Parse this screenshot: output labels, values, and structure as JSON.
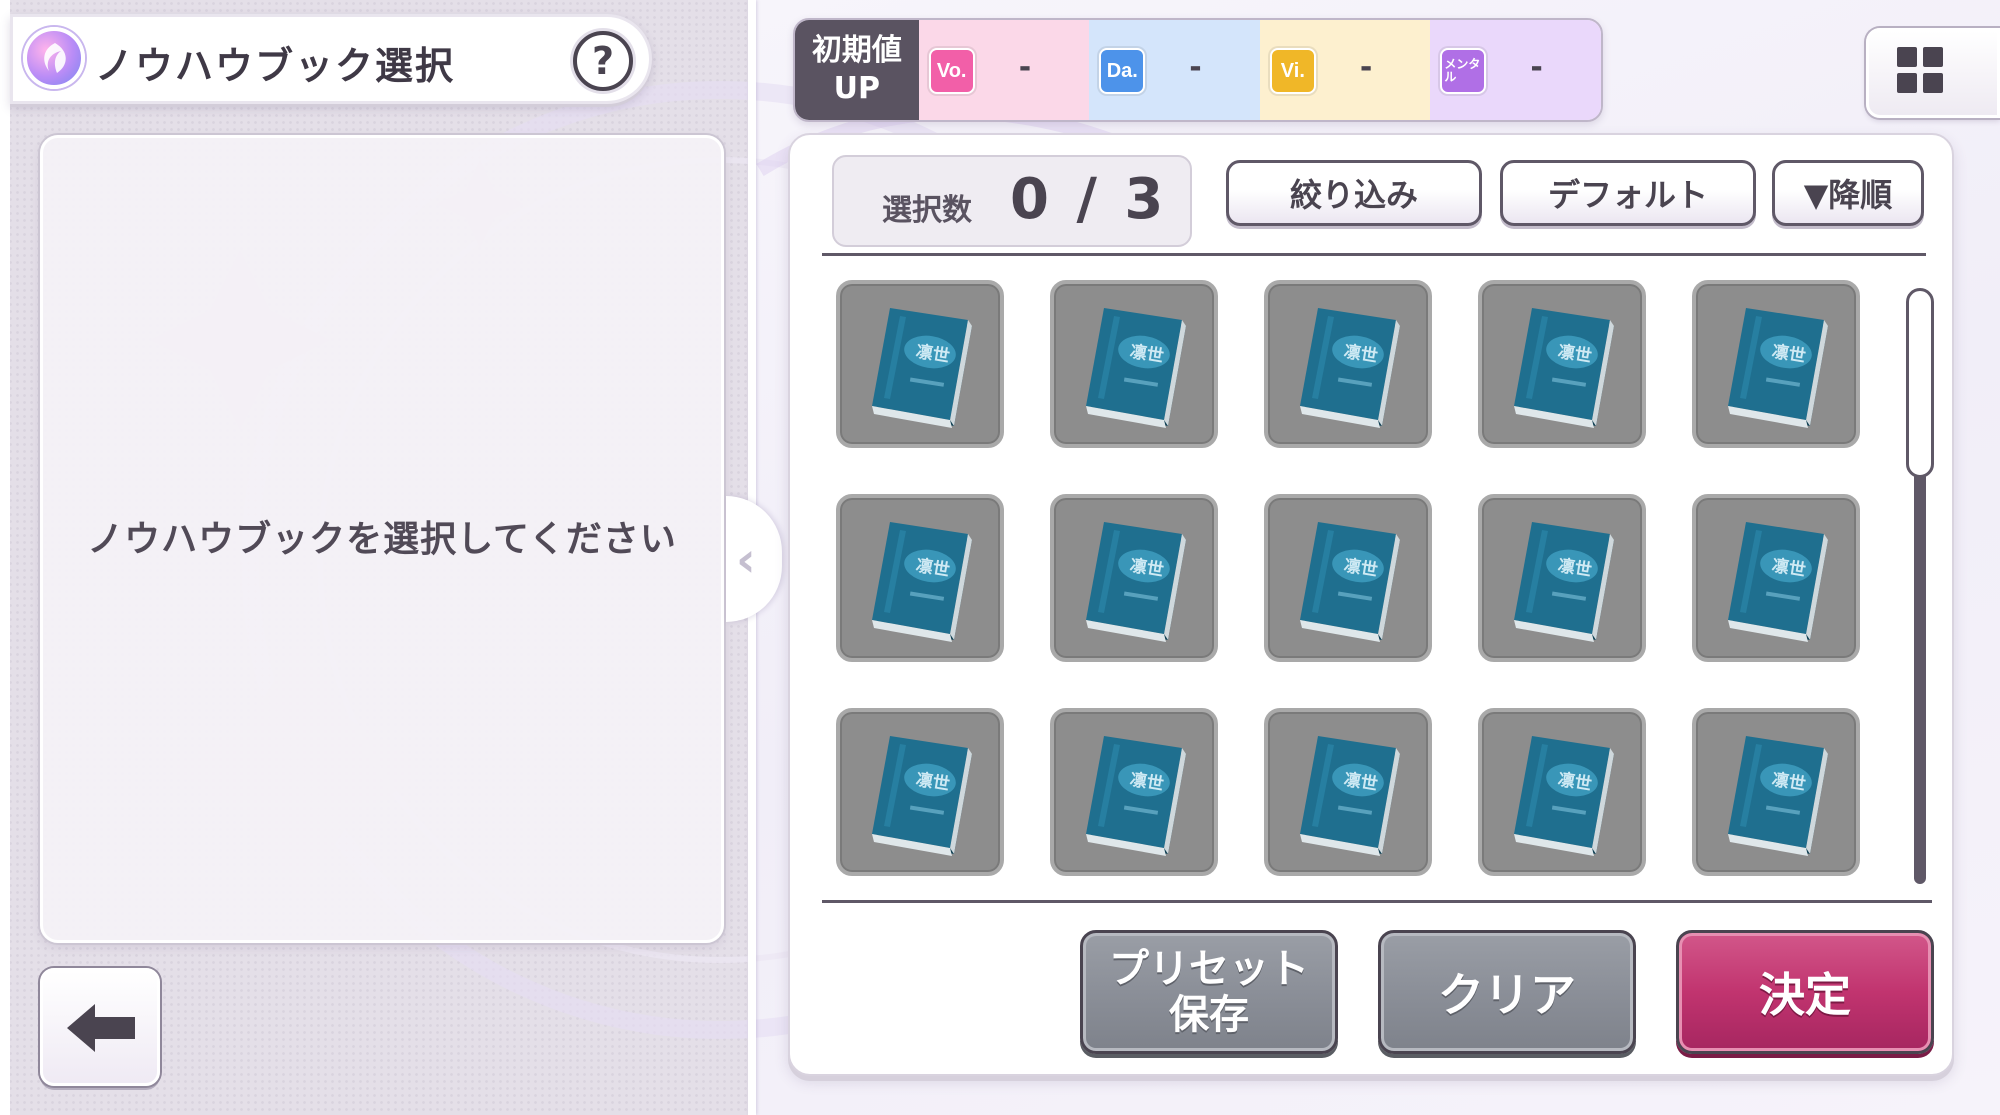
{
  "header": {
    "title": "ノウハウブック選択",
    "help_label": "?"
  },
  "info_panel": {
    "message": "ノウハウブックを選択してください"
  },
  "stat_bar": {
    "label_line1": "初期値",
    "label_line2": "UP",
    "stats": [
      {
        "badge": "Vo.",
        "value": "-",
        "bg": "#fbd8e8",
        "badge_color": "#f25fa8"
      },
      {
        "badge": "Da.",
        "value": "-",
        "bg": "#d4e5fb",
        "badge_color": "#4d93ea"
      },
      {
        "badge": "Vi.",
        "value": "-",
        "bg": "#fdf0cf",
        "badge_color": "#f0b728"
      },
      {
        "badge": "メンタル",
        "value": "-",
        "bg": "#ead8fb",
        "badge_color": "#b06fe6"
      }
    ]
  },
  "selection": {
    "label": "選択数",
    "count": "0 / 3"
  },
  "toolbar": {
    "filter_label": "絞り込み",
    "sort_label": "デフォルト",
    "order_label": "▼降順"
  },
  "grid": {
    "rows": 3,
    "cols": 5,
    "book_title": "凛世"
  },
  "actions": {
    "preset_save_line1": "プリセット",
    "preset_save_line2": "保存",
    "clear_label": "クリア",
    "confirm_label": "決定"
  },
  "colors": {
    "confirm": "#c1346f",
    "gray_button": "#8b8f98",
    "book_blue": "#1f6f8f"
  }
}
